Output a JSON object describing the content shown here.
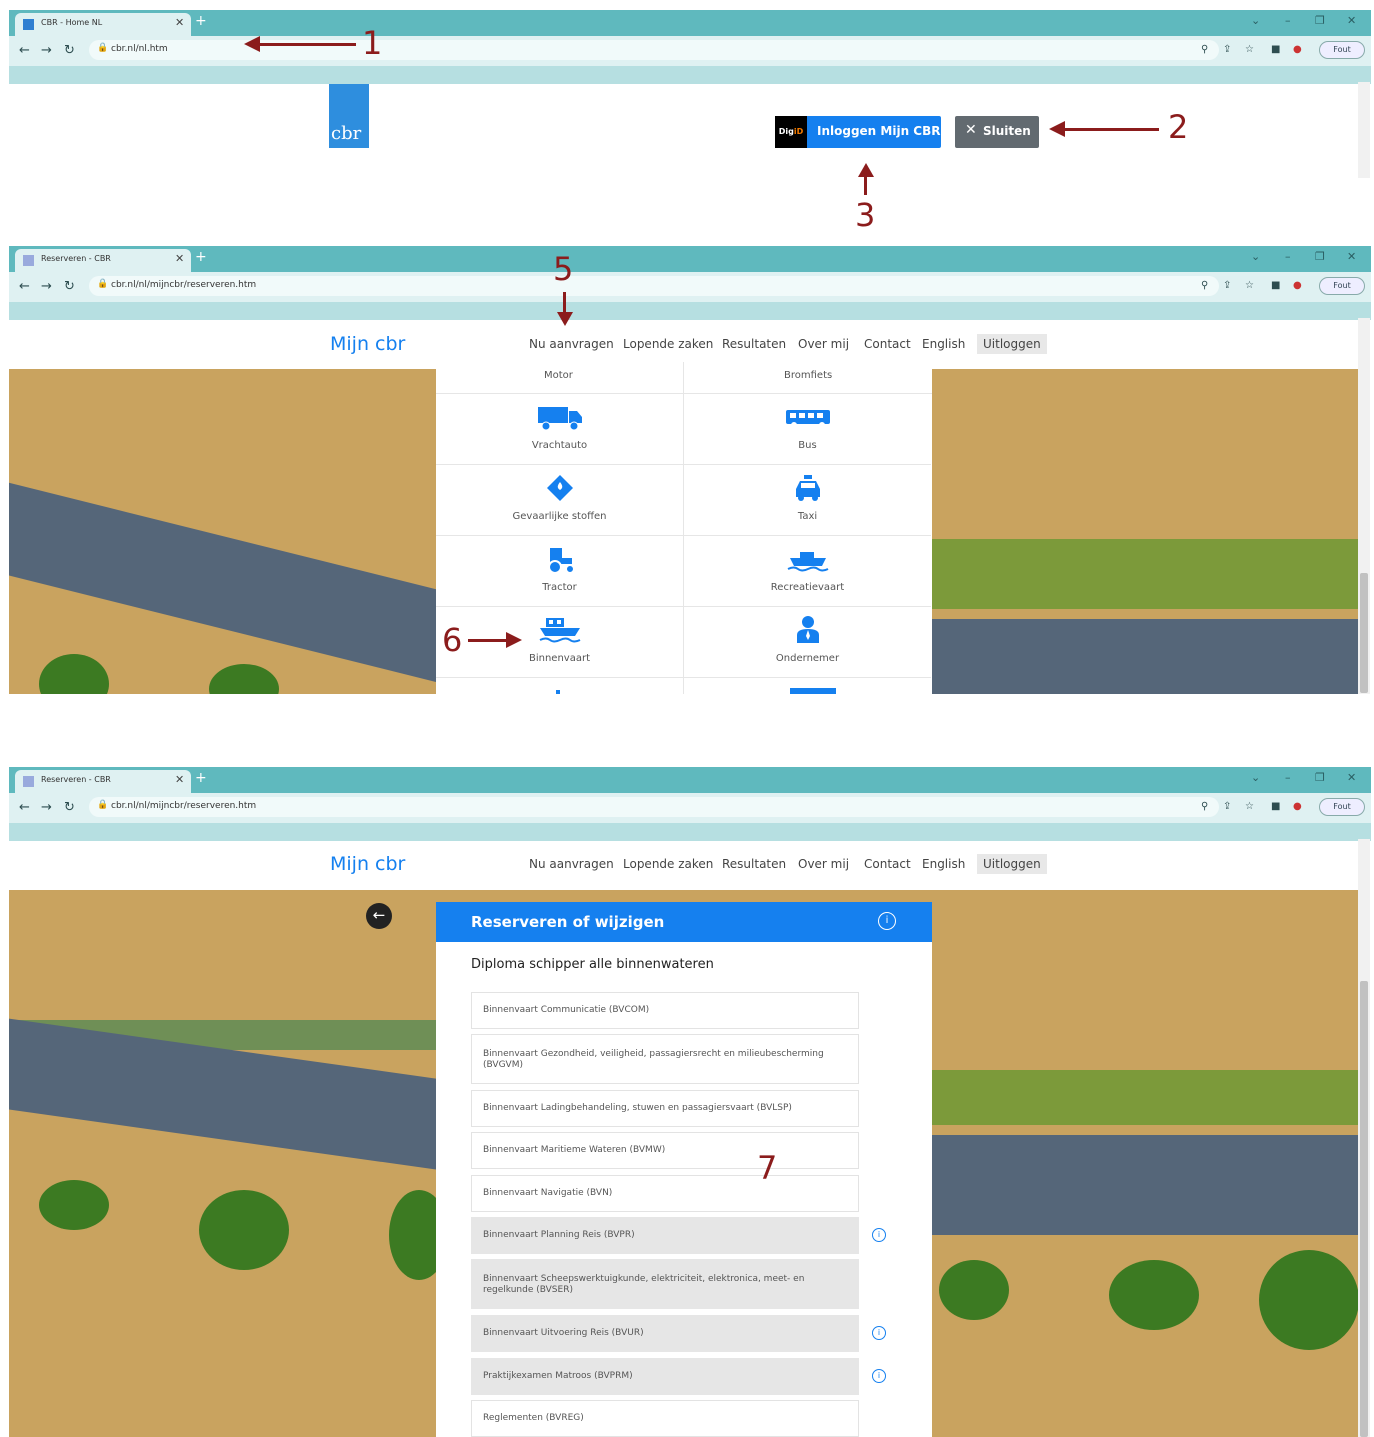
{
  "panel1": {
    "tab_title": "CBR - Home NL",
    "url": "cbr.nl/nl.htm",
    "logo_text": "cbr",
    "login_button": "Inloggen Mijn CBR",
    "digid_text_a": "Dig",
    "digid_text_b": "iD",
    "close_button": "Sluiten"
  },
  "panel2": {
    "tab_title": "Reserveren - CBR",
    "url": "cbr.nl/nl/mijncbr/reserveren.htm",
    "site_title": "Mijn cbr",
    "menu": [
      "Nu aanvragen",
      "Lopende zaken",
      "Resultaten",
      "Over mij",
      "Contact",
      "English",
      "Uitloggen"
    ],
    "dropdown_headers": [
      "Motor",
      "Bromfiets"
    ],
    "dropdown_items": [
      {
        "label": "Vrachtauto",
        "icon": "truck-icon"
      },
      {
        "label": "Bus",
        "icon": "bus-icon"
      },
      {
        "label": "Gevaarlijke stoffen",
        "icon": "hazard-diamond-icon"
      },
      {
        "label": "Taxi",
        "icon": "taxi-icon"
      },
      {
        "label": "Tractor",
        "icon": "tractor-icon"
      },
      {
        "label": "Recreatievaart",
        "icon": "boat-icon"
      },
      {
        "label": "Binnenvaart",
        "icon": "barge-icon"
      },
      {
        "label": "Ondernemer",
        "icon": "entrepreneur-icon"
      }
    ]
  },
  "panel3": {
    "tab_title": "Reserveren - CBR",
    "url": "cbr.nl/nl/mijncbr/reserveren.htm",
    "site_title": "Mijn cbr",
    "menu": [
      "Nu aanvragen",
      "Lopende zaken",
      "Resultaten",
      "Over mij",
      "Contact",
      "English",
      "Uitloggen"
    ],
    "card_title": "Reserveren of wijzigen",
    "card_subtitle": "Diploma schipper alle binnenwateren",
    "exams": [
      {
        "label": "Binnenvaart Communicatie (BVCOM)",
        "disabled": false,
        "info": false
      },
      {
        "label": "Binnenvaart Gezondheid, veiligheid, passagiersrecht en milieubescherming (BVGVM)",
        "disabled": false,
        "info": false
      },
      {
        "label": "Binnenvaart Ladingbehandeling, stuwen en passagiersvaart (BVLSP)",
        "disabled": false,
        "info": false
      },
      {
        "label": "Binnenvaart Maritieme Wateren (BVMW)",
        "disabled": false,
        "info": false
      },
      {
        "label": "Binnenvaart Navigatie (BVN)",
        "disabled": false,
        "info": false
      },
      {
        "label": "Binnenvaart Planning Reis (BVPR)",
        "disabled": true,
        "info": true
      },
      {
        "label": "Binnenvaart Scheepswerktuigkunde, elektriciteit, elektronica, meet- en regelkunde (BVSER)",
        "disabled": true,
        "info": false
      },
      {
        "label": "Binnenvaart Uitvoering Reis (BVUR)",
        "disabled": true,
        "info": true
      },
      {
        "label": "Praktijkexamen Matroos (BVPRM)",
        "disabled": true,
        "info": true
      },
      {
        "label": "Reglementen (BVREG)",
        "disabled": false,
        "info": false
      }
    ]
  },
  "browser": {
    "profile_label": "Fout"
  },
  "annotations": [
    "1",
    "2",
    "3",
    "5",
    "6",
    "7"
  ],
  "colors": {
    "chrome_tab_bar": "#5fb9be",
    "cbr_blue": "#1580ef",
    "annotation": "#8b1c1c"
  }
}
